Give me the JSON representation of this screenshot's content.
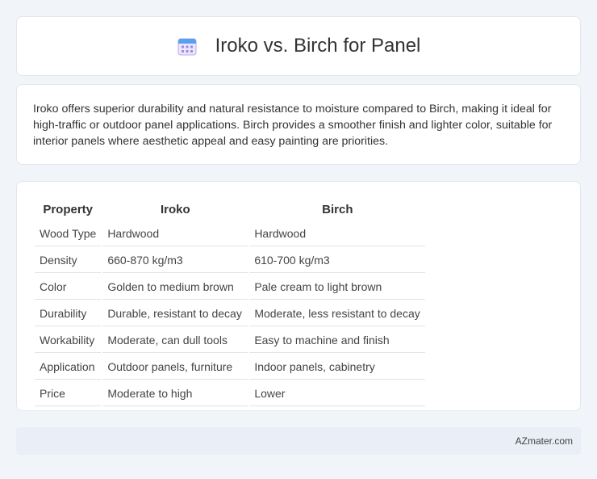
{
  "header": {
    "title": "Iroko vs. Birch for Panel",
    "icon": "calendar-icon"
  },
  "summary": {
    "text": "Iroko offers superior durability and natural resistance to moisture compared to Birch, making it ideal for high-traffic or outdoor panel applications. Birch provides a smoother finish and lighter color, suitable for interior panels where aesthetic appeal and easy painting are priorities."
  },
  "table": {
    "headers": [
      "Property",
      "Iroko",
      "Birch"
    ],
    "rows": [
      [
        "Wood Type",
        "Hardwood",
        "Hardwood"
      ],
      [
        "Density",
        "660-870 kg/m3",
        "610-700 kg/m3"
      ],
      [
        "Color",
        "Golden to medium brown",
        "Pale cream to light brown"
      ],
      [
        "Durability",
        "Durable, resistant to decay",
        "Moderate, less resistant to decay"
      ],
      [
        "Workability",
        "Moderate, can dull tools",
        "Easy to machine and finish"
      ],
      [
        "Application",
        "Outdoor panels, furniture",
        "Indoor panels, cabinetry"
      ],
      [
        "Price",
        "Moderate to high",
        "Lower"
      ]
    ]
  },
  "footer": {
    "text": "AZmater.com"
  }
}
